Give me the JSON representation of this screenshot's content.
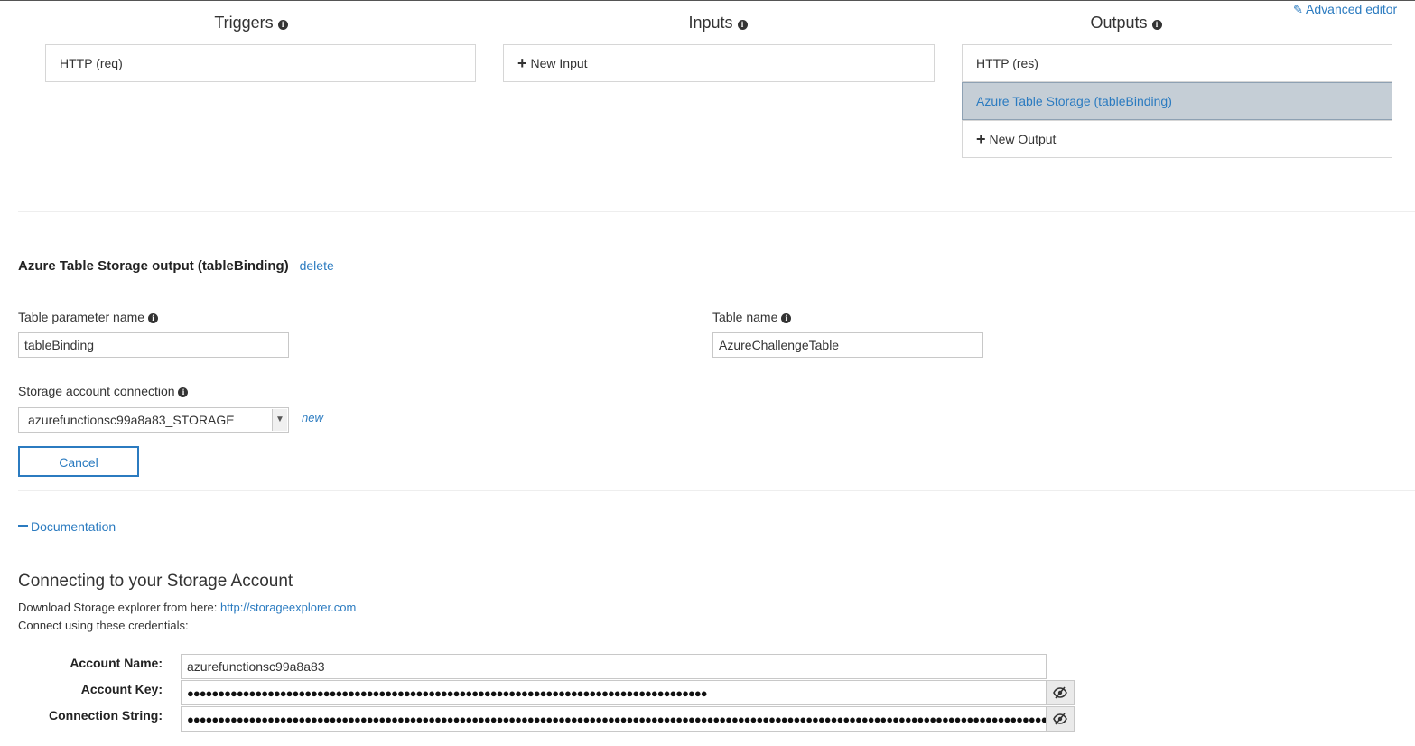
{
  "header": {
    "advanced_editor": "Advanced editor"
  },
  "columns": {
    "triggers": {
      "title": "Triggers",
      "items": [
        "HTTP (req)"
      ]
    },
    "inputs": {
      "title": "Inputs",
      "new_label": "New Input"
    },
    "outputs": {
      "title": "Outputs",
      "items": [
        "HTTP (res)",
        "Azure Table Storage (tableBinding)"
      ],
      "new_label": "New Output"
    }
  },
  "binding_editor": {
    "title": "Azure Table Storage output (tableBinding)",
    "delete_label": "delete",
    "table_param_label": "Table parameter name",
    "table_param_value": "tableBinding",
    "table_name_label": "Table name",
    "table_name_value": "AzureChallengeTable",
    "storage_label": "Storage account connection",
    "storage_value": "azurefunctionsc99a8a83_STORAGE",
    "new_label": "new",
    "cancel_label": "Cancel"
  },
  "documentation": {
    "toggle_label": "Documentation",
    "heading": "Connecting to your Storage Account",
    "download_text": "Download Storage explorer from here: ",
    "download_link": "http://storageexplorer.com",
    "connect_text": "Connect using these credentials:",
    "account_name_label": "Account Name:",
    "account_name_value": "azurefunctionsc99a8a83",
    "account_key_label": "Account Key:",
    "account_key_value": "●●●●●●●●●●●●●●●●●●●●●●●●●●●●●●●●●●●●●●●●●●●●●●●●●●●●●●●●●●●●●●●●●●●●●●●●●●●●●●●●●●●●",
    "connection_string_label": "Connection String:",
    "connection_string_value": "●●●●●●●●●●●●●●●●●●●●●●●●●●●●●●●●●●●●●●●●●●●●●●●●●●●●●●●●●●●●●●●●●●●●●●●●●●●●●●●●●●●●●●●●●●●●●●●●●●●●●●●●●●●●●●●●●●●●●●●●●●●●●●●●●●●●●●●●●●●●●●●●●●"
  },
  "colors": {
    "accent": "#2b7bc0",
    "selected_bg": "#c5ced6"
  }
}
